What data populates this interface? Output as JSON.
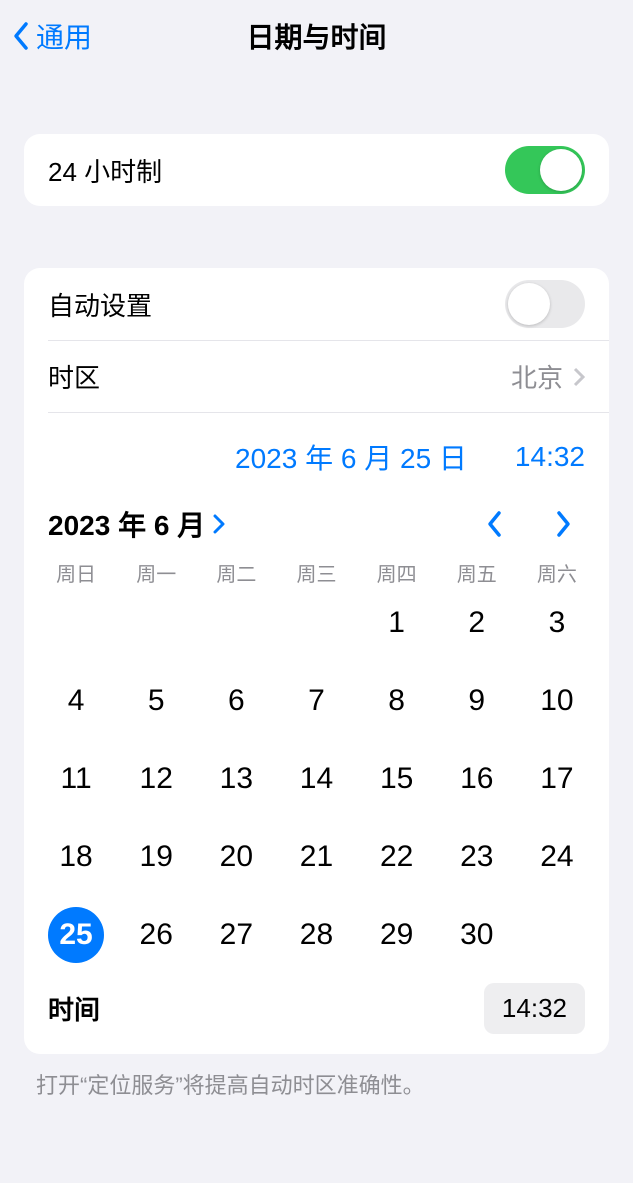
{
  "header": {
    "back_label": "通用",
    "title": "日期与时间"
  },
  "twenty_four": {
    "label": "24 小时制",
    "on": true
  },
  "auto_set": {
    "label": "自动设置",
    "on": false
  },
  "timezone": {
    "label": "时区",
    "value": "北京"
  },
  "picked": {
    "date": "2023 年 6 月 25 日",
    "time": "14:32"
  },
  "calendar": {
    "month_label": "2023 年 6 月",
    "weekdays": [
      "周日",
      "周一",
      "周二",
      "周三",
      "周四",
      "周五",
      "周六"
    ],
    "leading_blanks": 4,
    "days": 30,
    "selected": 25
  },
  "time_row": {
    "label": "时间",
    "value": "14:32"
  },
  "footer": "打开“定位服务”将提高自动时区准确性。"
}
